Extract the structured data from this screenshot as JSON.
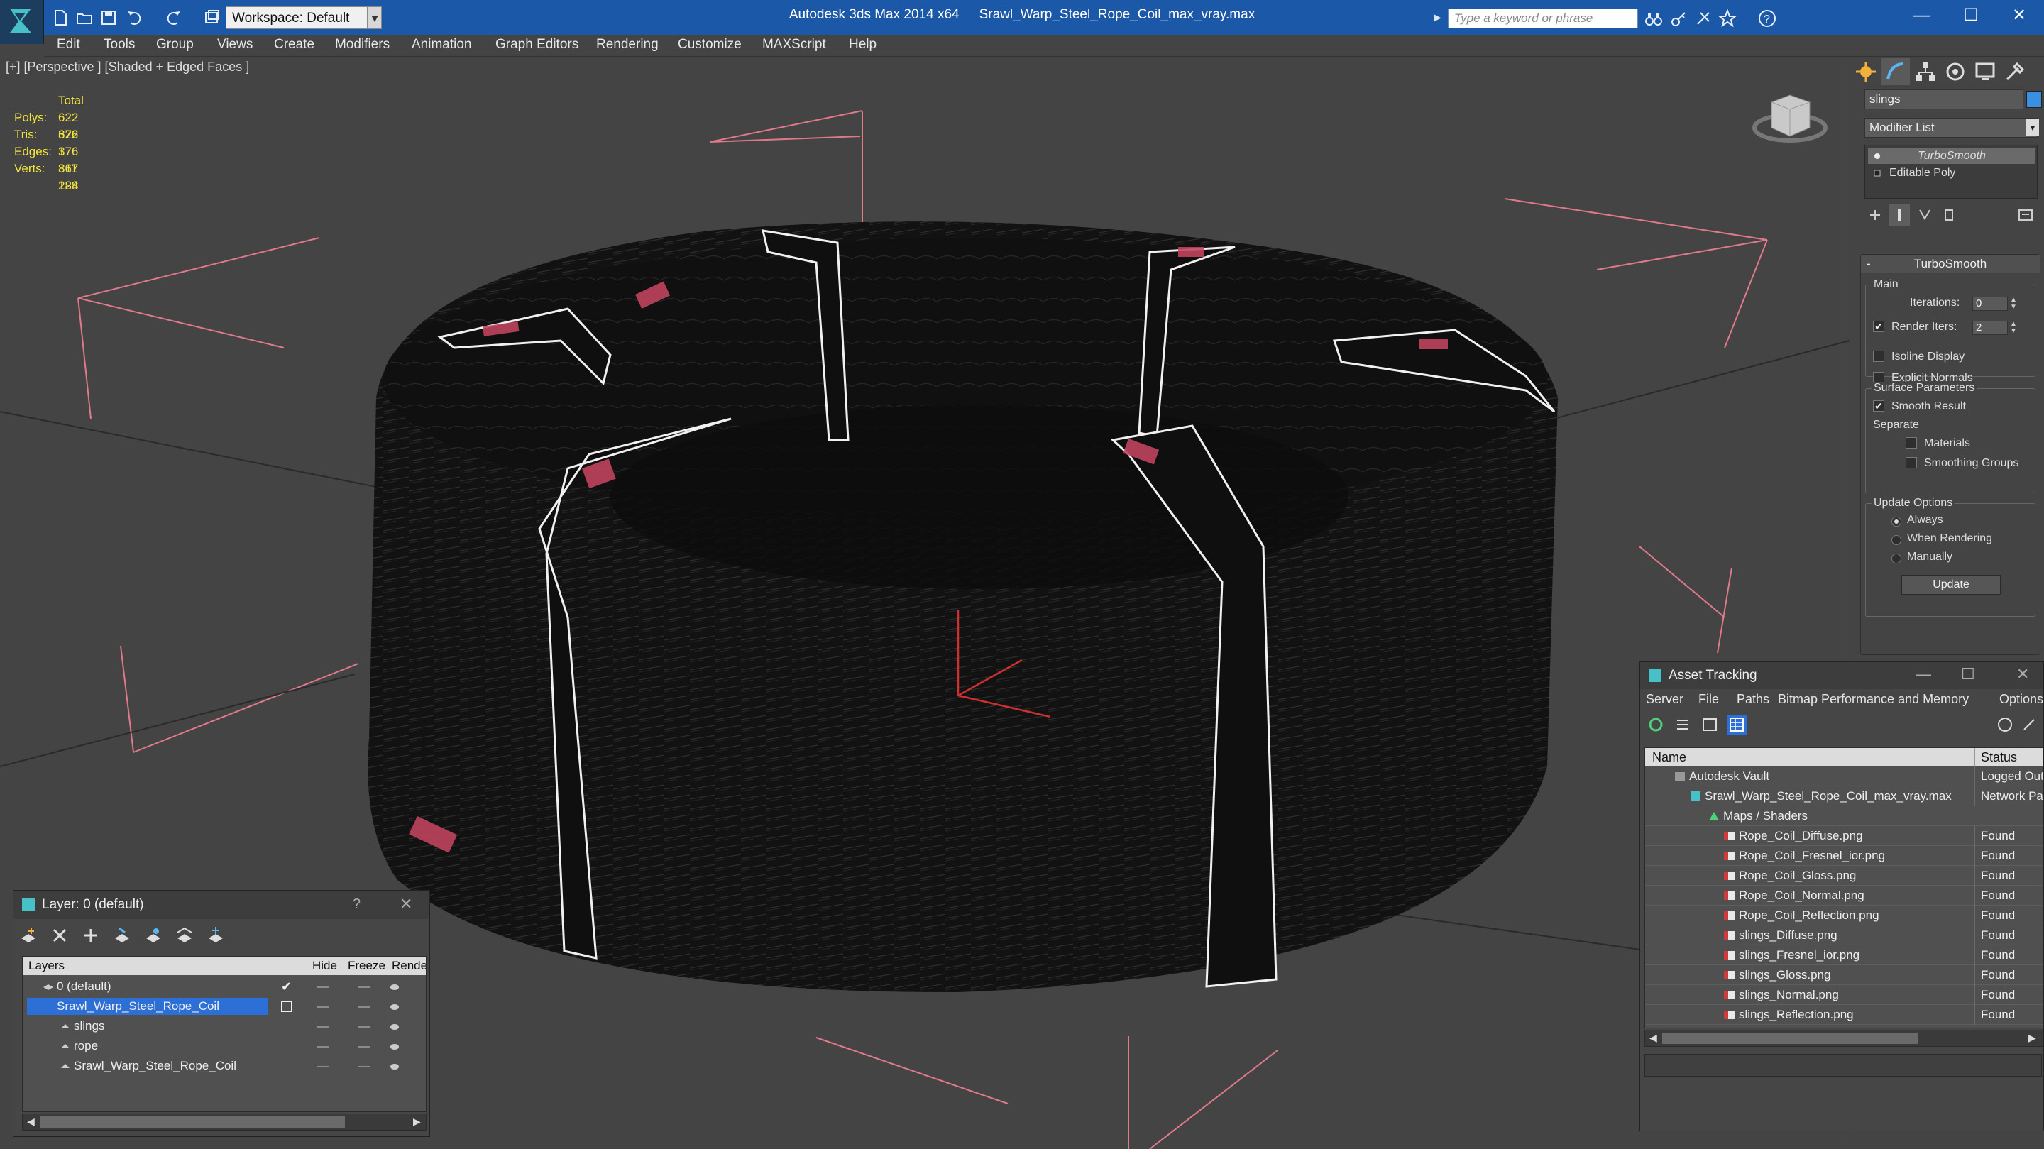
{
  "titlebar": {
    "workspace": "Workspace: Default",
    "app_name": "Autodesk 3ds Max  2014 x64",
    "file_name": "Srawl_Warp_Steel_Rope_Coil_max_vray.max",
    "search_placeholder": "Type a keyword or phrase",
    "minimize": "—",
    "maximize": "☐",
    "close": "✕"
  },
  "menu": [
    "Edit",
    "Tools",
    "Group",
    "Views",
    "Create",
    "Modifiers",
    "Animation",
    "Graph Editors",
    "Rendering",
    "Customize",
    "MAXScript",
    "Help"
  ],
  "viewport": {
    "label": "[+] [Perspective ] [Shaded + Edged Faces ]",
    "stats": {
      "total_label": "Total",
      "rows": [
        {
          "key": "Polys:",
          "value": "622 376"
        },
        {
          "key": "Tris:",
          "value": "622 376"
        },
        {
          "key": "Edges:",
          "value": "1 867 128"
        },
        {
          "key": "Verts:",
          "value": "311 284"
        }
      ]
    }
  },
  "command_panel": {
    "object_name": "slings",
    "modifier_list": "Modifier List",
    "stack": [
      "TurboSmooth",
      "Editable Poly"
    ],
    "rollout_title": "TurboSmooth",
    "main_group": "Main",
    "iterations_label": "Iterations:",
    "iterations_value": "0",
    "render_iters_label": "Render Iters:",
    "render_iters_value": "2",
    "isoline_display": "Isoline Display",
    "explicit_normals": "Explicit Normals",
    "surface_group": "Surface Parameters",
    "smooth_result": "Smooth Result",
    "separate_label": "Separate",
    "materials": "Materials",
    "smoothing_groups": "Smoothing Groups",
    "update_group": "Update Options",
    "always": "Always",
    "when_rendering": "When Rendering",
    "manually": "Manually",
    "update_button": "Update",
    "check": "✔"
  },
  "asset_tracking": {
    "title": "Asset Tracking",
    "menu": [
      "Server",
      "File",
      "Paths",
      "Bitmap Performance and Memory",
      "Options"
    ],
    "col_name": "Name",
    "col_status": "Status",
    "rows": [
      {
        "name": "Autodesk Vault",
        "status": "Logged Out"
      },
      {
        "name": "Srawl_Warp_Steel_Rope_Coil_max_vray.max",
        "status": "Network Pa"
      },
      {
        "name": "Maps / Shaders",
        "status": ""
      },
      {
        "name": "Rope_Coil_Diffuse.png",
        "status": "Found"
      },
      {
        "name": "Rope_Coil_Fresnel_ior.png",
        "status": "Found"
      },
      {
        "name": "Rope_Coil_Gloss.png",
        "status": "Found"
      },
      {
        "name": "Rope_Coil_Normal.png",
        "status": "Found"
      },
      {
        "name": "Rope_Coil_Reflection.png",
        "status": "Found"
      },
      {
        "name": "slings_Diffuse.png",
        "status": "Found"
      },
      {
        "name": "slings_Fresnel_ior.png",
        "status": "Found"
      },
      {
        "name": "slings_Gloss.png",
        "status": "Found"
      },
      {
        "name": "slings_Normal.png",
        "status": "Found"
      },
      {
        "name": "slings_Reflection.png",
        "status": "Found"
      }
    ]
  },
  "layers": {
    "title": "Layer: 0 (default)",
    "help": "?",
    "close": "✕",
    "col_layers": "Layers",
    "col_hide": "Hide",
    "col_freeze": "Freeze",
    "col_render": "Render",
    "check": "✔",
    "rows": [
      {
        "name": "0 (default)"
      },
      {
        "name": "Srawl_Warp_Steel_Rope_Coil"
      },
      {
        "name": "slings"
      },
      {
        "name": "rope"
      },
      {
        "name": "Srawl_Warp_Steel_Rope_Coil"
      }
    ]
  },
  "colors": {
    "titlebar": "#1c58a8",
    "selection": "#2c6fd6",
    "grid": "#e07a8a",
    "stats": "#f2e63c"
  }
}
